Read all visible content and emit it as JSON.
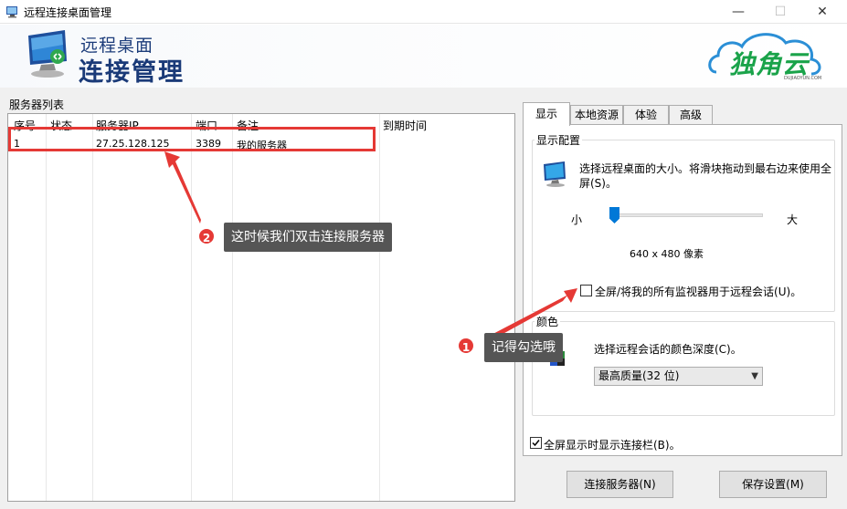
{
  "window": {
    "title": "远程连接桌面管理",
    "controls": {
      "minimize": "—",
      "maximize": "☐",
      "close": "✕"
    }
  },
  "banner": {
    "title_line1": "远程桌面",
    "title_line2": "连接管理",
    "brand": "独角云",
    "brand_sub": "DUJIAOYUN.COM"
  },
  "server_list": {
    "label": "服务器列表",
    "columns": [
      "序号",
      "状态",
      "服务器IP",
      "端口",
      "备注",
      "到期时间"
    ],
    "rows": [
      {
        "index": "1",
        "status": "",
        "ip": "27.25.128.125",
        "port": "3389",
        "note": "我的服务器",
        "expiry": ""
      }
    ]
  },
  "tabs": [
    {
      "label": "显示",
      "active": true
    },
    {
      "label": "本地资源",
      "active": false
    },
    {
      "label": "体验",
      "active": false
    },
    {
      "label": "高级",
      "active": false
    }
  ],
  "display": {
    "group_label": "显示配置",
    "description": "选择远程桌面的大小。将滑块拖动到最右边来使用全屏(S)。",
    "slider_min_label": "小",
    "slider_max_label": "大",
    "slider_value": 0,
    "resolution": "640 x 480 像素",
    "all_monitors_label": "全屏/将我的所有监视器用于远程会话(U)。",
    "all_monitors_checked": false
  },
  "color": {
    "group_label": "颜色",
    "description": "选择远程会话的颜色深度(C)。",
    "selected": "最高质量(32 位)"
  },
  "show_bar": {
    "label": "全屏显示时显示连接栏(B)。",
    "checked": true
  },
  "buttons": {
    "connect": "连接服务器(N)",
    "save": "保存设置(M)"
  },
  "annotations": [
    {
      "number": "1",
      "text": "记得勾选哦"
    },
    {
      "number": "2",
      "text": "这时候我们双击连接服务器"
    }
  ],
  "colors": {
    "accent": "#0078d7",
    "annotation": "#e53935",
    "callout_bg": "#555555",
    "brand_green": "#1aa34a",
    "banner_text": "#1a3a78"
  }
}
